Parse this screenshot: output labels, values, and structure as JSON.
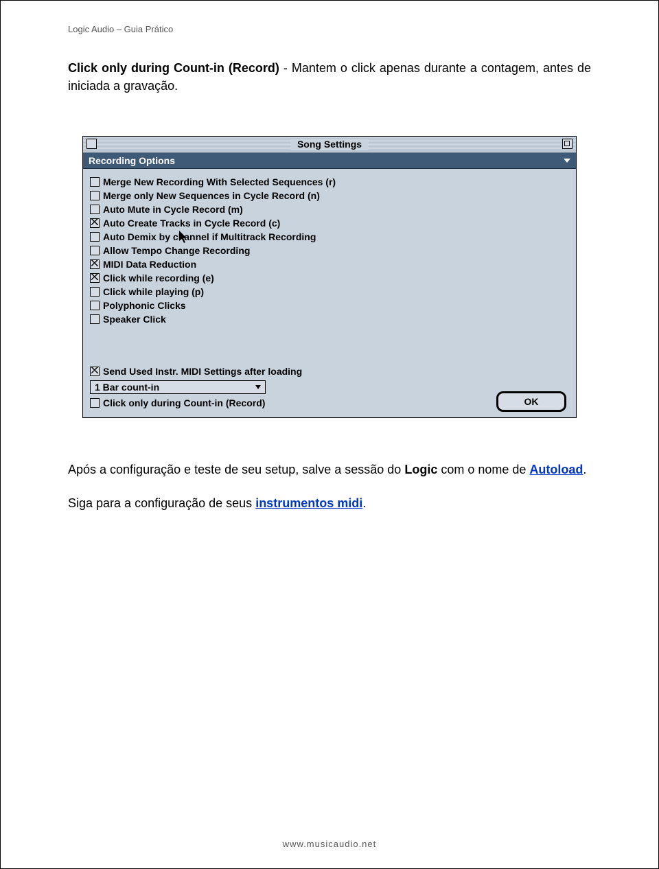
{
  "header": "Logic Audio – Guia Prático",
  "intro": {
    "bold_lead": "Click only during Count-in (Record)",
    "rest": " - Mantem o click apenas durante a contagem, antes de iniciada a gravação."
  },
  "window": {
    "title": "Song Settings",
    "section_title": "Recording Options",
    "options": [
      {
        "label": "Merge New Recording With Selected Sequences (r)",
        "checked": false
      },
      {
        "label": "Merge only New Sequences in Cycle Record (n)",
        "checked": false
      },
      {
        "label": "Auto Mute in Cycle Record (m)",
        "checked": false
      },
      {
        "label": "Auto Create Tracks in Cycle Record (c)",
        "checked": true
      },
      {
        "label": "Auto Demix by channel if Multitrack Recording",
        "checked": false
      },
      {
        "label": "Allow Tempo Change Recording",
        "checked": false
      },
      {
        "label": "MIDI Data Reduction",
        "checked": true
      },
      {
        "label": "Click while recording (e)",
        "checked": true
      },
      {
        "label": "Click while playing (p)",
        "checked": false
      },
      {
        "label": "Polyphonic Clicks",
        "checked": false
      },
      {
        "label": "Speaker Click",
        "checked": false
      }
    ],
    "send_midi": {
      "label": "Send Used Instr. MIDI Settings after loading",
      "checked": true
    },
    "dropdown_value": "1 Bar count-in",
    "click_countin": {
      "label": "Click only during Count-in (Record)",
      "checked": false
    },
    "ok_label": "OK"
  },
  "after": {
    "p1_a": "Após a configuração e teste de seu setup, salve a sessão do ",
    "p1_bold": "Logic",
    "p1_b": " com o nome de ",
    "p1_link": "Autoload",
    "p1_c": ".",
    "p2_a": "Siga para a configuração de seus ",
    "p2_link": "instrumentos midi",
    "p2_b": "."
  },
  "footer": "www.musicaudio.net"
}
